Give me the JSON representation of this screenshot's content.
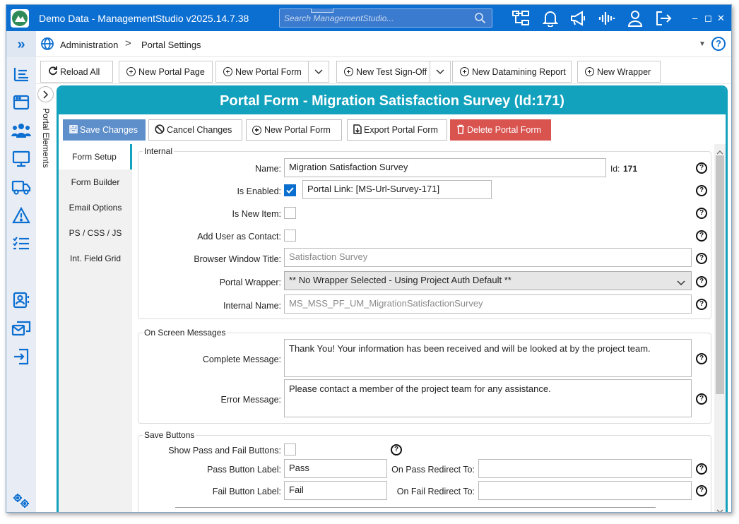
{
  "app": {
    "title": "Demo Data - ManagementStudio v2025.14.7.38",
    "search_placeholder": "Search ManagementStudio...",
    "minimize": "–",
    "restore": "◻",
    "close": "✕"
  },
  "icons": {
    "expand": "»",
    "menu": "▼",
    "help": "?",
    "chevron_right": ">",
    "dropdown": "⌄"
  },
  "breadcrumb": {
    "root": "Administration",
    "current": "Portal Settings"
  },
  "toolbar": {
    "reload": "Reload All",
    "new_page": "New Portal Page",
    "new_form": "New Portal Form",
    "new_test": "New Test Sign-Off",
    "new_datamining": "New Datamining Report",
    "new_wrapper": "New Wrapper"
  },
  "portal_elements_label": "Portal Elements",
  "panel": {
    "title": "Portal Form -  Migration Satisfaction Survey  (Id:171)"
  },
  "actions": {
    "save": "Save Changes",
    "cancel": "Cancel Changes",
    "new_form": "New Portal Form",
    "export": "Export Portal Form",
    "delete": "Delete Portal Form"
  },
  "nav": [
    "Form Setup",
    "Form Builder",
    "Email Options",
    "PS / CSS / JS",
    "Int. Field Grid"
  ],
  "internal": {
    "group": "Internal",
    "name_label": "Name:",
    "name_value": "Migration Satisfaction Survey",
    "id_label": "Id:",
    "id_value": "171",
    "enabled_label": "Is Enabled:",
    "enabled": true,
    "portal_link": "Portal Link: [MS-Url-Survey-171]",
    "new_item_label": "Is New Item:",
    "new_item": false,
    "add_user_label": "Add User as Contact:",
    "add_user": false,
    "browser_title_label": "Browser Window Title:",
    "browser_title_placeholder": "Satisfaction Survey",
    "wrapper_label": "Portal Wrapper:",
    "wrapper_value": "** No Wrapper Selected - Using Project Auth Default **",
    "internal_name_label": "Internal Name:",
    "internal_name_placeholder": "MS_MSS_PF_UM_MigrationSatisfactionSurvey"
  },
  "messages": {
    "group": "On Screen Messages",
    "complete_label": "Complete Message:",
    "complete_value": "Thank You! Your information has been received and will be looked at by the project team.",
    "error_label": "Error Message:",
    "error_value": "Please contact a member of the project team for any assistance."
  },
  "save_buttons": {
    "group": "Save Buttons",
    "show_label": "Show Pass and Fail Buttons:",
    "show": false,
    "pass_label": "Pass Button Label:",
    "pass_value": "Pass",
    "pass_redirect_label": "On Pass Redirect To:",
    "pass_redirect_value": "",
    "fail_label": "Fail Button Label:",
    "fail_value": "Fail",
    "fail_redirect_label": "On Fail Redirect To:",
    "fail_redirect_value": ""
  },
  "colors": {
    "titlebar": "#0b6ed1",
    "accent": "#13a2bd",
    "save": "#5e8fca",
    "delete": "#d9534f",
    "checked": "#0a6fcf"
  }
}
